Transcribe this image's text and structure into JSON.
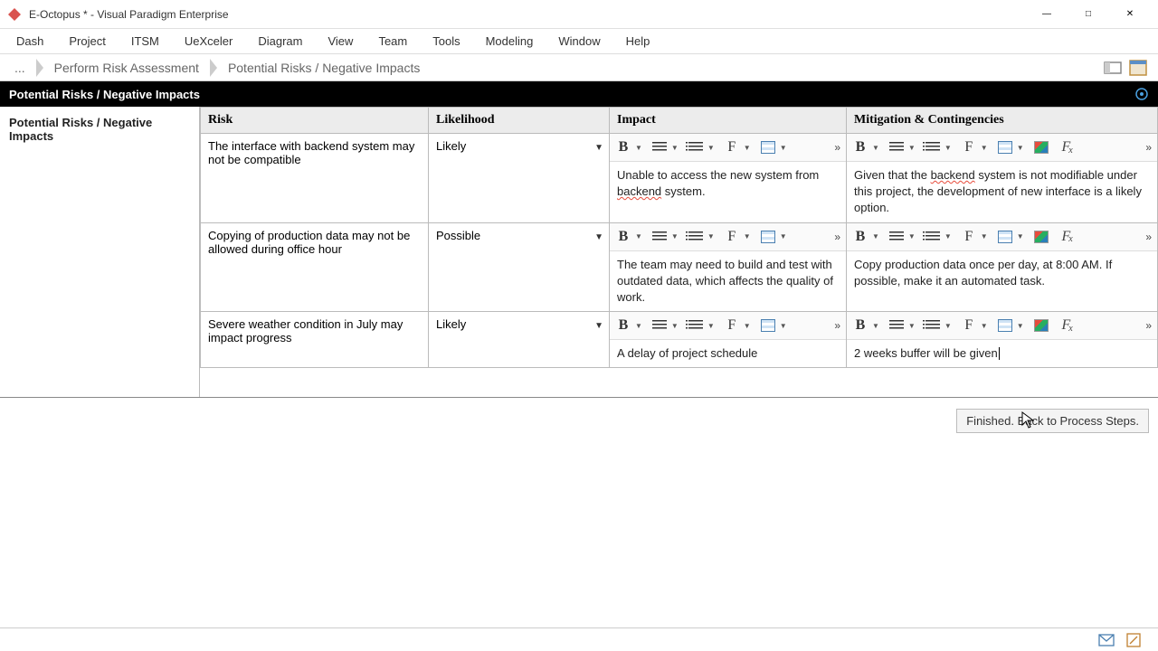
{
  "window": {
    "title": "E-Octopus * - Visual Paradigm Enterprise"
  },
  "menu": [
    "Dash",
    "Project",
    "ITSM",
    "UeXceler",
    "Diagram",
    "View",
    "Team",
    "Tools",
    "Modeling",
    "Window",
    "Help"
  ],
  "breadcrumb": {
    "root": "...",
    "items": [
      "Perform Risk Assessment",
      "Potential Risks / Negative Impacts"
    ]
  },
  "header": {
    "title": "Potential Risks / Negative Impacts"
  },
  "sidebar": {
    "label": "Potential Risks / Negative Impacts"
  },
  "table": {
    "columns": {
      "risk": "Risk",
      "likelihood": "Likelihood",
      "impact": "Impact",
      "mitigation": "Mitigation & Contingencies"
    },
    "rows": [
      {
        "risk": "The interface with backend system may not be compatible",
        "likelihood": "Likely",
        "impact_pre": "Unable to access the new system from ",
        "impact_mark": "backend",
        "impact_post": " system.",
        "mitigation_pre": "Given that the ",
        "mitigation_mark": "backend",
        "mitigation_post": " system is not modifiable under this project, the development of new interface is a likely option."
      },
      {
        "risk": "Copying of production data may not be allowed during office hour",
        "likelihood": "Possible",
        "impact": "The team may need to build and test with outdated data, which affects the quality of work.",
        "mitigation": "Copy production data once per day, at 8:00 AM. If possible, make it an automated task."
      },
      {
        "risk": "Severe weather condition in July may impact progress",
        "likelihood": "Likely",
        "impact": "A delay of project schedule",
        "mitigation": "2 weeks buffer will be given"
      }
    ]
  },
  "footer": {
    "finish": "Finished. Back to Process Steps."
  },
  "toolbar_labels": {
    "bold": "B",
    "font": "F",
    "more": "»"
  }
}
